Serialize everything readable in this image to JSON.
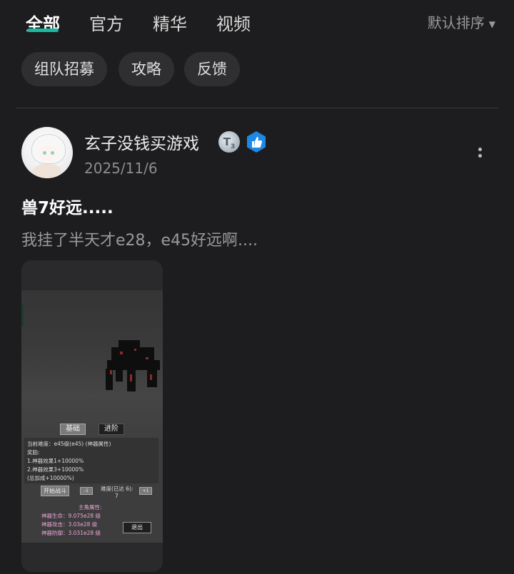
{
  "tabs": [
    {
      "label": "全部",
      "active": true
    },
    {
      "label": "官方",
      "active": false
    },
    {
      "label": "精华",
      "active": false
    },
    {
      "label": "视频",
      "active": false
    }
  ],
  "sort": {
    "label": "默认排序",
    "icon": "caret-down-icon"
  },
  "chips": [
    "组队招募",
    "攻略",
    "反馈"
  ],
  "post": {
    "author": "玄子没钱买游戏",
    "date": "2025/11/6",
    "badges": {
      "level": "T",
      "level_num": "3",
      "thumb_icon": "thumbs-up-badge-icon"
    },
    "title": "兽7好远.....",
    "body": "我挂了半天才e28，e45好远啊....",
    "image": {
      "btn_basic": "基础",
      "btn_advanced": "进阶",
      "info_lines": [
        "当前难度：e45级(e45) (神器属性)",
        "奖励:",
        "1.神器效果1+10000%",
        "2.神器效果3+10000%",
        "(总加成+10000%)"
      ],
      "btn_start": "开始战斗",
      "btn_dec": "-1",
      "difficulty_label": "难度(已达 6):",
      "difficulty_value": "7",
      "btn_inc": "+1",
      "stats_title": "主角属性:",
      "stat_hp": "神器生命：9.075e28 级",
      "stat_atk": "神器攻击：3.03e28 级",
      "stat_def": "神器防御：3.031e28 级",
      "btn_exit": "退出"
    }
  },
  "colors": {
    "accent": "#19b8a0",
    "background": "#1d1d1f",
    "badge_blue": "#1e88e5"
  }
}
